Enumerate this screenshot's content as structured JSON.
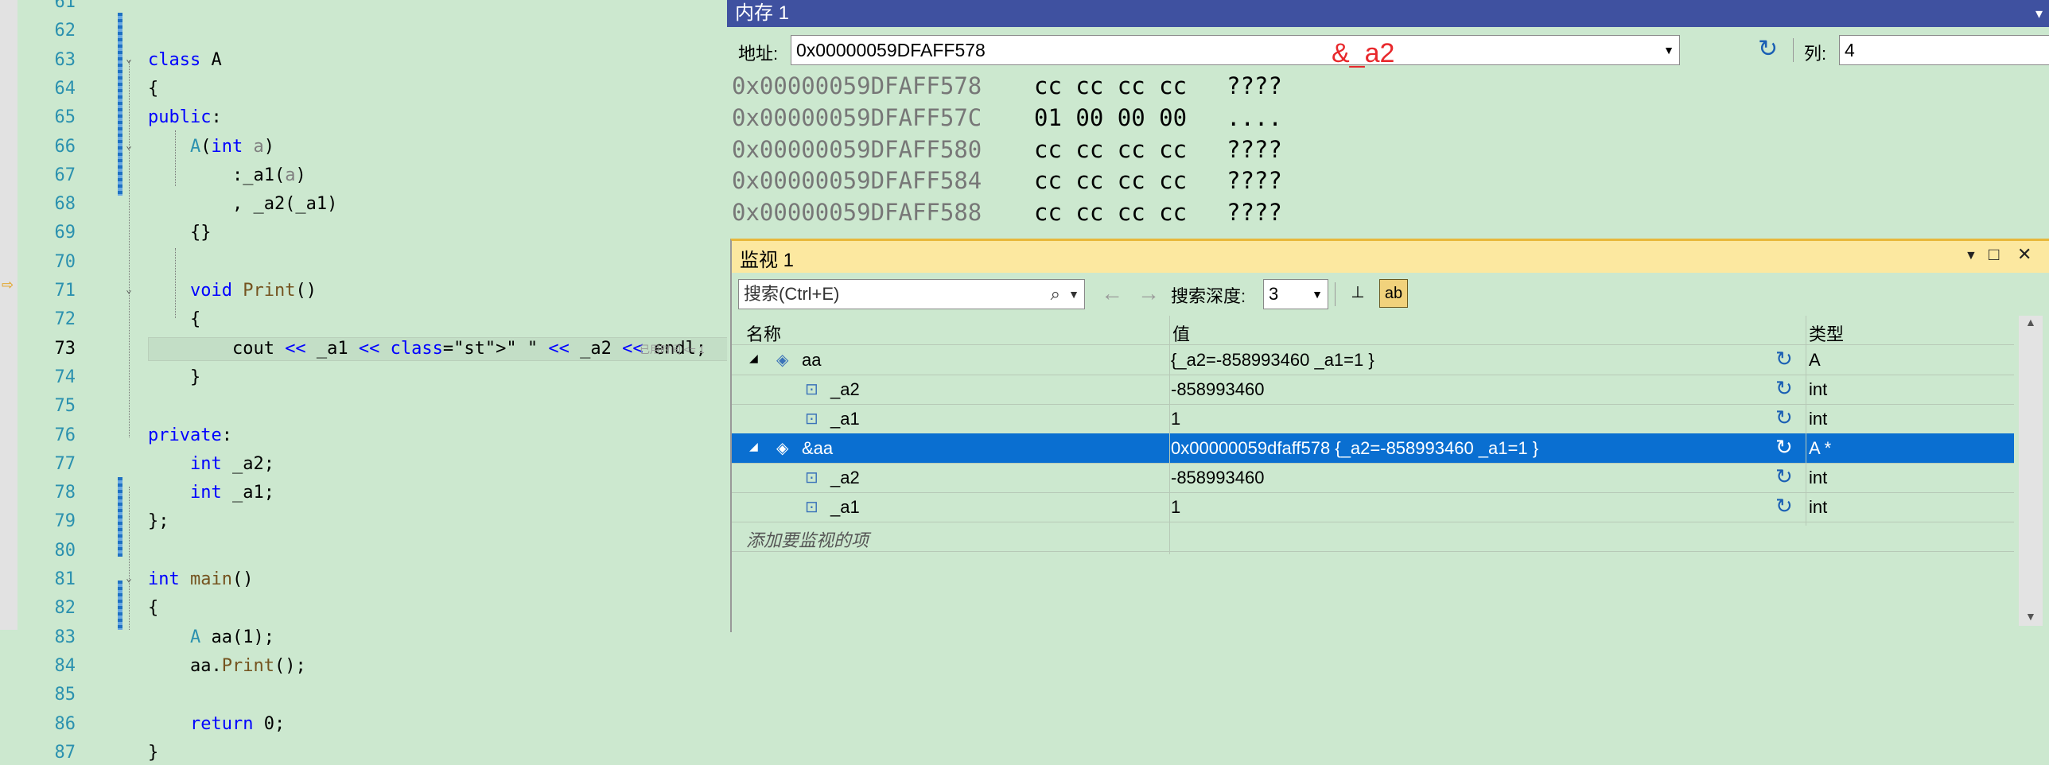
{
  "editor": {
    "lines": [
      {
        "n": "61",
        "code": ""
      },
      {
        "n": "62",
        "code": ""
      },
      {
        "n": "63",
        "code": "class A",
        "fold": true
      },
      {
        "n": "64",
        "code": "{"
      },
      {
        "n": "65",
        "code": "public:"
      },
      {
        "n": "66",
        "code": "    A(int a)",
        "fold": true
      },
      {
        "n": "67",
        "code": "        :_a1(a)"
      },
      {
        "n": "68",
        "code": "        , _a2(_a1)"
      },
      {
        "n": "69",
        "code": "    {}"
      },
      {
        "n": "70",
        "code": ""
      },
      {
        "n": "71",
        "code": "    void Print()",
        "fold": true
      },
      {
        "n": "72",
        "code": "    {"
      },
      {
        "n": "73",
        "code": "        cout << _a1 << \" \" << _a2 << endl;",
        "current": true
      },
      {
        "n": "74",
        "code": "    }"
      },
      {
        "n": "75",
        "code": ""
      },
      {
        "n": "76",
        "code": "private:"
      },
      {
        "n": "77",
        "code": "    int _a2;"
      },
      {
        "n": "78",
        "code": "    int _a1;"
      },
      {
        "n": "79",
        "code": "};"
      },
      {
        "n": "80",
        "code": ""
      },
      {
        "n": "81",
        "code": "int main()",
        "fold": true
      },
      {
        "n": "82",
        "code": "{"
      },
      {
        "n": "83",
        "code": "    A aa(1);"
      },
      {
        "n": "84",
        "code": "    aa.Print();"
      },
      {
        "n": "85",
        "code": ""
      },
      {
        "n": "86",
        "code": "    return 0;"
      },
      {
        "n": "87",
        "code": "}"
      }
    ],
    "elapsed_hint": "已用时间 <= 1",
    "colors": {
      "keyword": "#0000ff",
      "type": "#2b91af",
      "background": "#cce8cf"
    }
  },
  "memory": {
    "title": "内存 1",
    "address_label": "地址:",
    "address_value": "0x00000059DFAFF578",
    "column_label": "列:",
    "column_value": "4",
    "annotation": "&_a2",
    "rows": [
      {
        "addr": "0x00000059DFAFF578",
        "bytes": "cc cc cc cc",
        "ascii": "????"
      },
      {
        "addr": "0x00000059DFAFF57C",
        "bytes": "01 00 00 00",
        "ascii": "...."
      },
      {
        "addr": "0x00000059DFAFF580",
        "bytes": "cc cc cc cc",
        "ascii": "????"
      },
      {
        "addr": "0x00000059DFAFF584",
        "bytes": "cc cc cc cc",
        "ascii": "????"
      },
      {
        "addr": "0x00000059DFAFF588",
        "bytes": "cc cc cc cc",
        "ascii": "????"
      }
    ]
  },
  "watch": {
    "title": "监视 1",
    "search_placeholder": "搜索(Ctrl+E)",
    "depth_label": "搜索深度:",
    "depth_value": "3",
    "headers": {
      "name": "名称",
      "value": "值",
      "type": "类型"
    },
    "rows": [
      {
        "level": 0,
        "expanded": true,
        "name": "aa",
        "value": "{_a2=-858993460 _a1=1 }",
        "type": "A",
        "selected": false
      },
      {
        "level": 1,
        "name": "_a2",
        "value": "-858993460",
        "type": "int",
        "selected": false
      },
      {
        "level": 1,
        "name": "_a1",
        "value": "1",
        "type": "int",
        "selected": false
      },
      {
        "level": 0,
        "expanded": true,
        "name": "&aa",
        "value": "0x00000059dfaff578 {_a2=-858993460 _a1=1 }",
        "type": "A *",
        "selected": true
      },
      {
        "level": 1,
        "name": "_a2",
        "value": "-858993460",
        "type": "int",
        "selected": false
      },
      {
        "level": 1,
        "name": "_a1",
        "value": "1",
        "type": "int",
        "selected": false
      }
    ],
    "add_placeholder": "添加要监视的项",
    "colors": {
      "selection": "#0a6fd1",
      "title_bar": "#fce8a0"
    }
  }
}
